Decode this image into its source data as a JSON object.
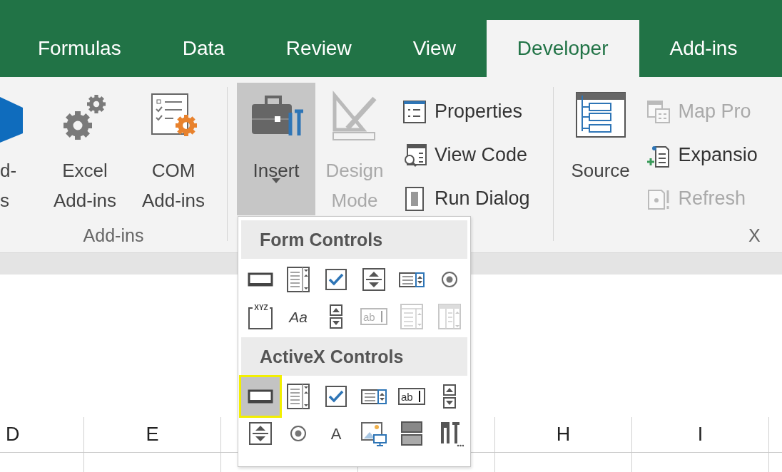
{
  "ribbon_tabs": [
    {
      "label": "Formulas",
      "selected": false
    },
    {
      "label": "Data",
      "selected": false
    },
    {
      "label": "Review",
      "selected": false
    },
    {
      "label": "View",
      "selected": false
    },
    {
      "label": "Developer",
      "selected": true
    },
    {
      "label": "Add-ins",
      "selected": false
    }
  ],
  "groups": [
    {
      "label": "Add-ins",
      "large_buttons": [
        {
          "kind": "store",
          "lines": [
            "d-",
            "s"
          ],
          "disabled": false,
          "expanded": false
        },
        {
          "kind": "gears",
          "lines": [
            "Excel",
            "Add-ins"
          ],
          "disabled": false,
          "expanded": false
        },
        {
          "kind": "com",
          "lines": [
            "COM",
            "Add-ins"
          ],
          "disabled": false,
          "expanded": false
        }
      ]
    },
    {
      "large_buttons": [
        {
          "kind": "toolbox",
          "lines": [
            "Insert"
          ],
          "dropdown": true,
          "disabled": false,
          "expanded": true
        },
        {
          "kind": "design",
          "lines": [
            "Design",
            "Mode"
          ],
          "disabled": true,
          "expanded": false
        }
      ],
      "small_buttons": [
        {
          "kind": "properties",
          "label": "Properties",
          "disabled": false
        },
        {
          "kind": "viewcode",
          "label": "View Code",
          "disabled": false
        },
        {
          "kind": "rundialog",
          "label": "Run Dialog",
          "disabled": false
        }
      ]
    },
    {
      "label": "X",
      "large_buttons": [
        {
          "kind": "source",
          "lines": [
            "Source"
          ],
          "disabled": false,
          "expanded": false
        }
      ],
      "small_buttons": [
        {
          "kind": "mapprops",
          "label": "Map Pro",
          "disabled": true
        },
        {
          "kind": "expansion",
          "label": "Expansio",
          "disabled": false
        },
        {
          "kind": "refresh",
          "label": "Refresh",
          "disabled": true
        }
      ]
    }
  ],
  "insert_menu": {
    "sections": [
      {
        "title": "Form Controls",
        "items": [
          {
            "kind": "button",
            "selected": false,
            "disabled": false
          },
          {
            "kind": "combo-box",
            "selected": false,
            "disabled": false
          },
          {
            "kind": "check-box",
            "selected": false,
            "disabled": false
          },
          {
            "kind": "spin-button",
            "selected": false,
            "disabled": false
          },
          {
            "kind": "list-box",
            "selected": false,
            "disabled": false
          },
          {
            "kind": "option-button",
            "selected": false,
            "disabled": false
          },
          {
            "kind": "group-box",
            "glyph": "XYZ",
            "selected": false,
            "disabled": false
          },
          {
            "kind": "label",
            "glyph": "Aa",
            "selected": false,
            "disabled": false
          },
          {
            "kind": "scroll-bar",
            "selected": false,
            "disabled": false
          },
          {
            "kind": "text-field",
            "glyph": "ab",
            "selected": false,
            "disabled": true
          },
          {
            "kind": "combo-list",
            "selected": false,
            "disabled": true
          },
          {
            "kind": "combo-drop-down",
            "selected": false,
            "disabled": true
          }
        ]
      },
      {
        "title": "ActiveX Controls",
        "items": [
          {
            "kind": "button",
            "selected": true,
            "disabled": false
          },
          {
            "kind": "combo-box",
            "selected": false,
            "disabled": false
          },
          {
            "kind": "check-box",
            "selected": false,
            "disabled": false
          },
          {
            "kind": "list-box",
            "selected": false,
            "disabled": false
          },
          {
            "kind": "text-field",
            "glyph": "ab",
            "selected": false,
            "disabled": false
          },
          {
            "kind": "scroll-bar",
            "selected": false,
            "disabled": false
          },
          {
            "kind": "spin-button",
            "selected": false,
            "disabled": false
          },
          {
            "kind": "option-button",
            "selected": false,
            "disabled": false
          },
          {
            "kind": "label",
            "glyph": "A",
            "selected": false,
            "disabled": false
          },
          {
            "kind": "image",
            "selected": false,
            "disabled": false
          },
          {
            "kind": "toggle-button",
            "selected": false,
            "disabled": false
          },
          {
            "kind": "more-controls",
            "selected": false,
            "disabled": false
          }
        ]
      }
    ]
  },
  "column_headers": [
    {
      "label": "D"
    },
    {
      "label": "E"
    },
    {
      "label": "H"
    },
    {
      "label": "I"
    }
  ]
}
